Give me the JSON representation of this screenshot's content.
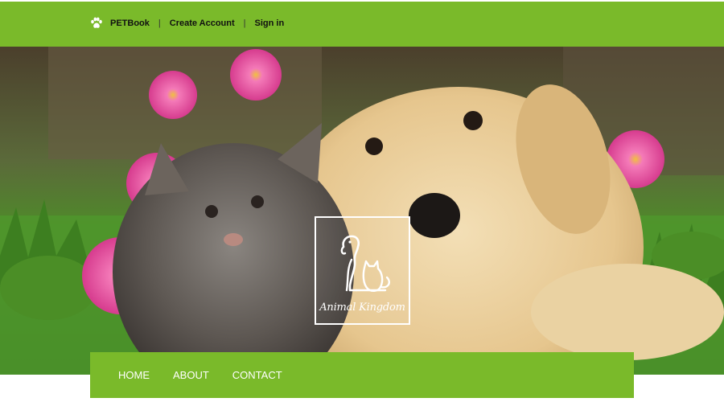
{
  "header": {
    "brand": "PETBook",
    "separator": "|",
    "create_account": "Create Account",
    "sign_in": "Sign in",
    "brand_icon": "paw-icon"
  },
  "hero": {
    "logo_text": "Animal Kingdom",
    "logo_icon": "dog-cat-silhouette-icon"
  },
  "nav": {
    "items": [
      {
        "label": "HOME"
      },
      {
        "label": "ABOUT"
      },
      {
        "label": "CONTACT"
      }
    ]
  },
  "colors": {
    "accent": "#7aba2a",
    "nav_text": "#ffffff",
    "top_text": "#111111"
  }
}
